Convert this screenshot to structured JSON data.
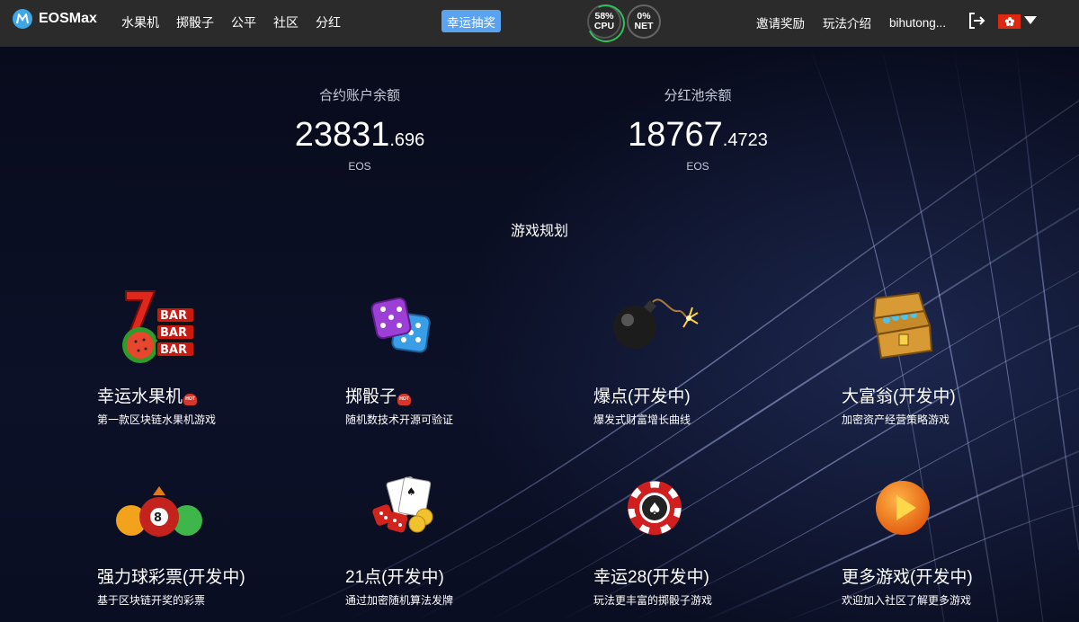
{
  "header": {
    "logo_text": "EOSMax",
    "nav": [
      "水果机",
      "掷骰子",
      "公平",
      "社区",
      "分红"
    ],
    "lucky_draw": "幸运抽奖",
    "cpu": {
      "percent": "58%",
      "label": "CPU",
      "value": 0.58
    },
    "net": {
      "percent": "0%",
      "label": "NET",
      "value": 0
    },
    "invite": "邀请奖励",
    "howto": "玩法介绍",
    "account": "bihutong..."
  },
  "balances": {
    "contract": {
      "label": "合约账户余额",
      "int": "23831",
      "dec": ".696",
      "unit": "EOS"
    },
    "dividend": {
      "label": "分红池余额",
      "int": "18767",
      "dec": ".4723",
      "unit": "EOS"
    }
  },
  "section_title": "游戏规划",
  "games": [
    {
      "name": "幸运水果机",
      "hot": true,
      "desc": "第一款区块链水果机游戏",
      "icon": "slot-machine-icon"
    },
    {
      "name": "掷骰子",
      "hot": true,
      "desc": "随机数技术开源可验证",
      "icon": "dice-icon"
    },
    {
      "name": "爆点(开发中)",
      "hot": false,
      "desc": "爆发式财富增长曲线",
      "icon": "bomb-icon"
    },
    {
      "name": "大富翁(开发中)",
      "hot": false,
      "desc": "加密资产经营策略游戏",
      "icon": "treasure-chest-icon"
    },
    {
      "name": "强力球彩票(开发中)",
      "hot": false,
      "desc": "基于区块链开奖的彩票",
      "icon": "lottery-balls-icon"
    },
    {
      "name": "21点(开发中)",
      "hot": false,
      "desc": "通过加密随机算法发牌",
      "icon": "cards-icon"
    },
    {
      "name": "幸运28(开发中)",
      "hot": false,
      "desc": "玩法更丰富的掷骰子游戏",
      "icon": "poker-chip-icon"
    },
    {
      "name": "更多游戏(开发中)",
      "hot": false,
      "desc": "欢迎加入社区了解更多游戏",
      "icon": "play-icon"
    }
  ],
  "hot_badge": "HOT"
}
